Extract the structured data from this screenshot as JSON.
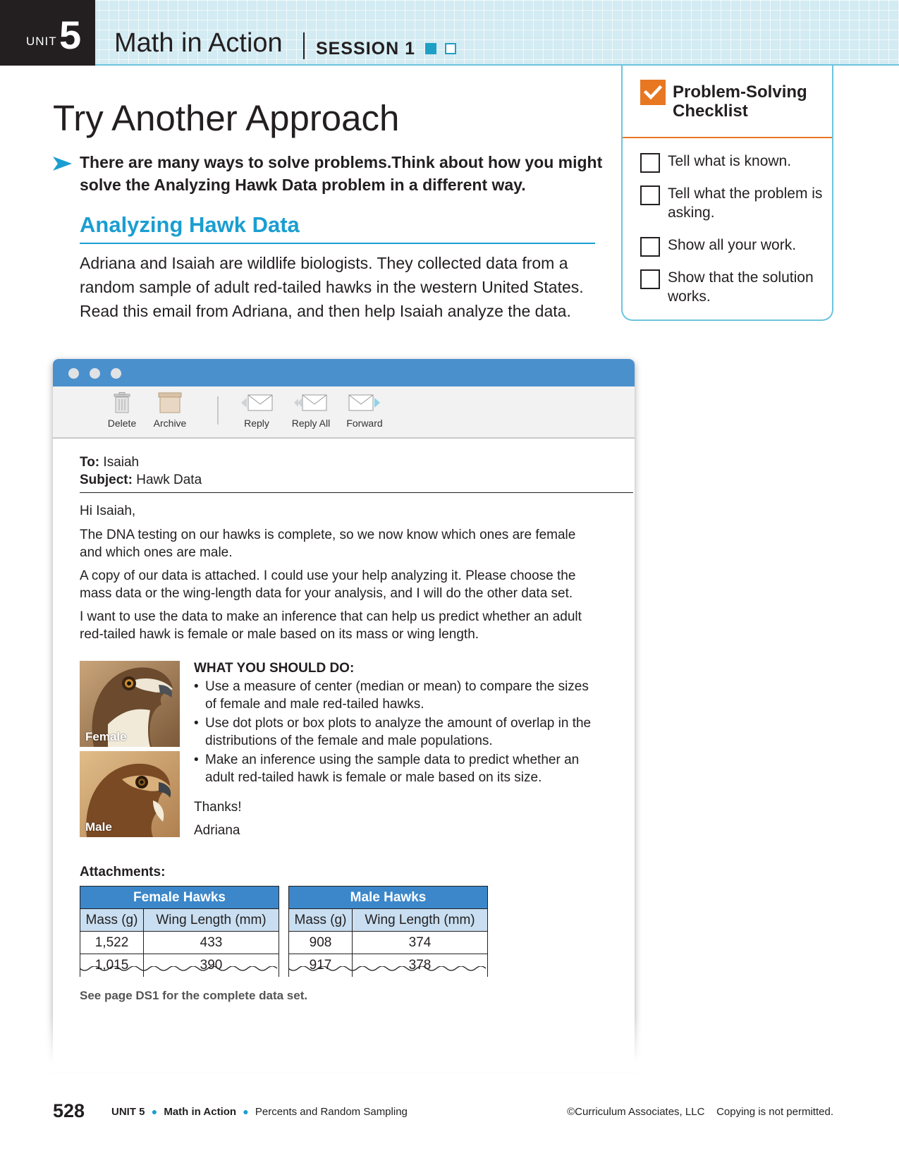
{
  "header": {
    "unit_word": "UNIT",
    "unit_number": "5",
    "title": "Math in Action",
    "session": "SESSION 1"
  },
  "page_title": "Try Another Approach",
  "intro": "There are many ways to solve problems.Think about how you might solve the Analyzing Hawk Data problem in a different way.",
  "section": {
    "heading": "Analyzing Hawk Data",
    "paragraph": "Adriana and Isaiah are wildlife biologists. They collected data from a random sample of adult red-tailed hawks in the western United States. Read this email from Adriana, and then help Isaiah analyze the data."
  },
  "checklist": {
    "title": "Problem-Solving Checklist",
    "items": [
      "Tell what is known.",
      "Tell what the problem is asking.",
      "Show all your work.",
      "Show that the solution works."
    ]
  },
  "email": {
    "toolbar": {
      "delete": "Delete",
      "archive": "Archive",
      "reply": "Reply",
      "reply_all": "Reply All",
      "forward": "Forward"
    },
    "to_label": "To:",
    "to": "Isaiah",
    "subject_label": "Subject:",
    "subject": "Hawk Data",
    "greeting": "Hi Isaiah,",
    "paragraphs": [
      "The DNA testing on our hawks is complete, so we now know which ones are female and which ones are male.",
      "A copy of our data is attached. I could use your help analyzing it. Please choose the mass data or the wing-length data for your analysis, and I will do the other data set.",
      "I want to use the data to make an inference that can help us predict whether an adult red-tailed hawk is female or male based on its mass or wing length."
    ],
    "photos": {
      "female": "Female",
      "male": "Male"
    },
    "todo_heading": "WHAT YOU SHOULD DO:",
    "todo": [
      "Use a measure of center (median or mean) to compare the sizes of female and male red-tailed hawks.",
      "Use dot plots or box plots to analyze the amount of overlap in the distributions of the female and male populations.",
      "Make an inference using the sample data to predict whether an adult red-tailed hawk is female or male based on its size."
    ],
    "thanks": "Thanks!",
    "signature": "Adriana",
    "attachments_label": "Attachments:",
    "female_table": {
      "title": "Female Hawks",
      "columns": [
        "Mass (g)",
        "Wing Length (mm)"
      ],
      "rows": [
        [
          "1,522",
          "433"
        ],
        [
          "1,015",
          "390"
        ]
      ]
    },
    "male_table": {
      "title": "Male Hawks",
      "columns": [
        "Mass (g)",
        "Wing Length (mm)"
      ],
      "rows": [
        [
          "908",
          "374"
        ],
        [
          "917",
          "378"
        ]
      ]
    },
    "see_page": "See page DS1 for the complete data set."
  },
  "footer": {
    "page_number": "528",
    "unit": "UNIT 5",
    "section": "Math in Action",
    "topic": "Percents and Random Sampling",
    "copyright": "©Curriculum Associates, LLC",
    "notice": "Copying is not permitted."
  },
  "colors": {
    "accent_blue": "#1a9ed1",
    "header_band": "#d3ebf2",
    "checklist_orange": "#e87722",
    "email_titlebar": "#4a90cd",
    "table_header": "#3b87c9"
  }
}
